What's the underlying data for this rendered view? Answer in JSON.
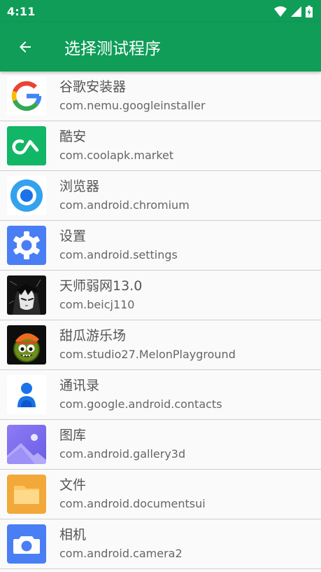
{
  "status_bar": {
    "time": "4:11",
    "icons": [
      "wifi-icon",
      "signal-icon",
      "battery-charging-icon"
    ]
  },
  "app_bar": {
    "title": "选择测试程序",
    "back_icon": "back-arrow-icon",
    "color": "#0f9d58"
  },
  "apps": [
    {
      "name": "谷歌安装器",
      "package": "com.nemu.googleinstaller",
      "icon": "google-icon"
    },
    {
      "name": "酷安",
      "package": "com.coolapk.market",
      "icon": "coolapk-icon"
    },
    {
      "name": "浏览器",
      "package": "com.android.chromium",
      "icon": "browser-icon"
    },
    {
      "name": "设置",
      "package": "com.android.settings",
      "icon": "settings-gear-icon"
    },
    {
      "name": "天师弱网13.0",
      "package": "com.beicj110",
      "icon": "anime-character-icon"
    },
    {
      "name": "甜瓜游乐场",
      "package": "com.studio27.MelonPlayground",
      "icon": "melon-character-icon"
    },
    {
      "name": "通讯录",
      "package": "com.google.android.contacts",
      "icon": "contacts-person-icon"
    },
    {
      "name": "图库",
      "package": "com.android.gallery3d",
      "icon": "gallery-icon"
    },
    {
      "name": "文件",
      "package": "com.android.documentsui",
      "icon": "folder-icon"
    },
    {
      "name": "相机",
      "package": "com.android.camera2",
      "icon": "camera-icon"
    }
  ]
}
